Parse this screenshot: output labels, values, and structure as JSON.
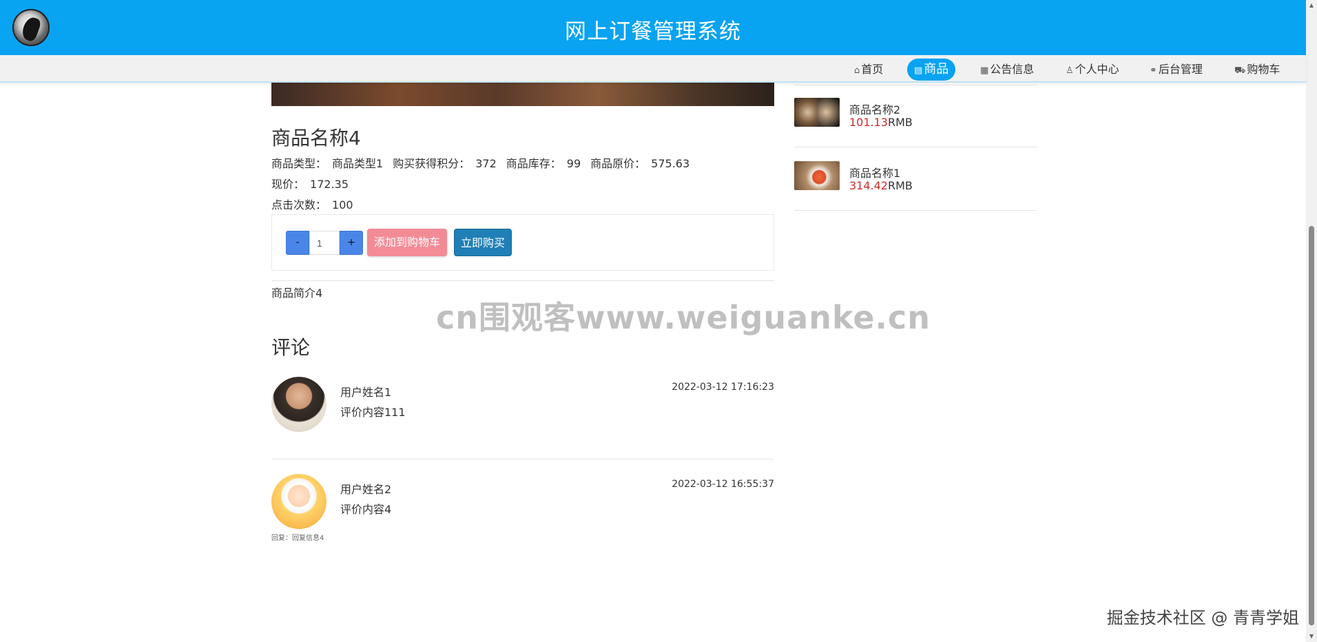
{
  "header": {
    "title": "网上订餐管理系统"
  },
  "nav": {
    "items": [
      {
        "label": "首页",
        "icon": "home-icon"
      },
      {
        "label": "商品",
        "icon": "goods-icon",
        "active": true
      },
      {
        "label": "公告信息",
        "icon": "grid-icon"
      },
      {
        "label": "个人中心",
        "icon": "user-icon"
      },
      {
        "label": "后台管理",
        "icon": "link-icon"
      },
      {
        "label": "购物车",
        "icon": "cart-icon"
      }
    ]
  },
  "product": {
    "name": "商品名称4",
    "meta": [
      {
        "label": "商品类型：",
        "value": "商品类型1"
      },
      {
        "label": "购买获得积分：",
        "value": "372"
      },
      {
        "label": "商品库存：",
        "value": "99"
      },
      {
        "label": "商品原价：",
        "value": "575.63"
      },
      {
        "label": "现价：",
        "value": "172.35"
      },
      {
        "label": "点击次数：",
        "value": "100"
      }
    ],
    "quantity": "1",
    "minus_label": "-",
    "plus_label": "+",
    "add_to_cart_label": "添加到购物车",
    "buy_now_label": "立即购买",
    "intro": "商品简介4"
  },
  "comments": {
    "title": "评论",
    "items": [
      {
        "user": "用户姓名1",
        "text": "评价内容111",
        "time": "2022-03-12 17:16:23"
      },
      {
        "user": "用户姓名2",
        "text": "评价内容4",
        "time": "2022-03-12 16:55:37",
        "reply": "回复：回复信息4"
      }
    ]
  },
  "sidebar": {
    "items": [
      {
        "name": "商品名称2",
        "price": "101.13",
        "unit": "RMB"
      },
      {
        "name": "商品名称1",
        "price": "314.42",
        "unit": "RMB"
      }
    ]
  },
  "watermarks": {
    "center": "cn围观客www.weiguanke.cn",
    "corner": "掘金技术社区 @ 青青学姐"
  },
  "colors": {
    "primary": "#08a3f1",
    "price": "#d02a2a",
    "cart_button": "#f28b96",
    "buy_button": "#1f7fb6"
  }
}
